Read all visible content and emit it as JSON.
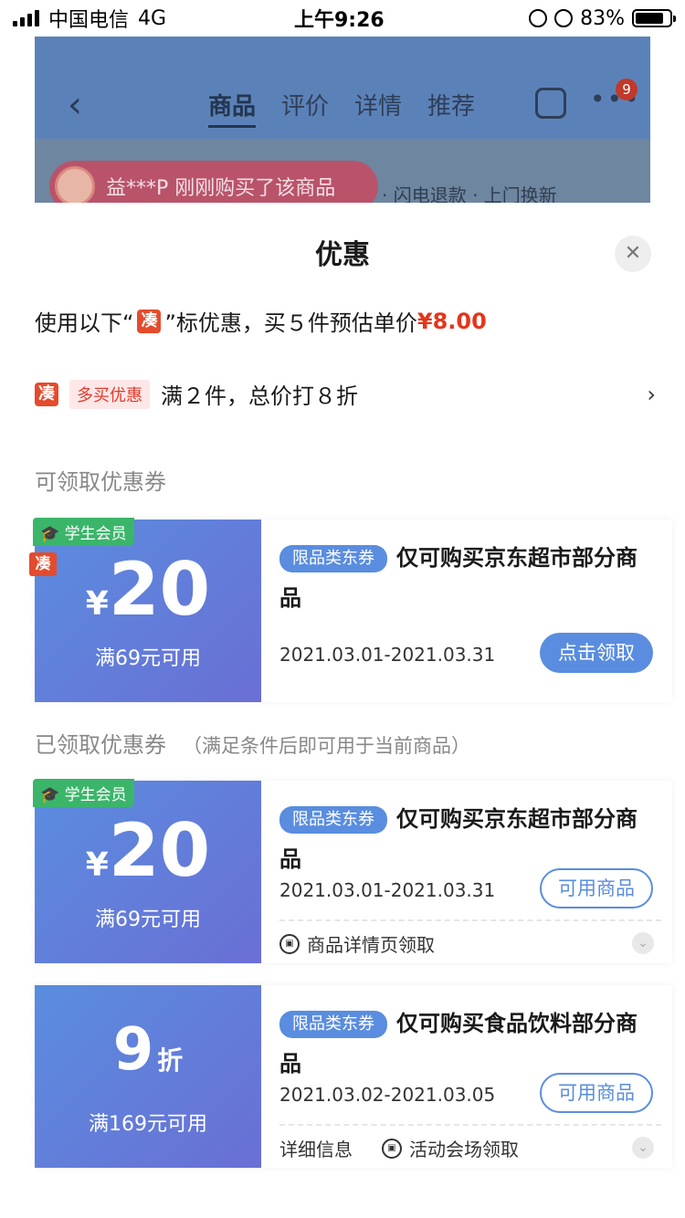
{
  "status_bar": {
    "carrier": "中国电信",
    "network": "4G",
    "time": "上午9:26",
    "battery": "83%",
    "battery_level": 0.83
  },
  "nav": {
    "tabs": [
      "商品",
      "评价",
      "详情",
      "推荐"
    ],
    "badge": "9"
  },
  "banner": {
    "buyer_text": "益***P 刚刚购买了该商品",
    "promo_text": "· 闪电退款 · 上门换新"
  },
  "sheet": {
    "title": "优惠",
    "summary": {
      "prefix": "使用以下“",
      "tag": "凑",
      "suffix": "”标优惠，买５件预估单价",
      "price": "¥8.00"
    },
    "multi_buy": {
      "tag": "凑",
      "label": "多买优惠",
      "text": "满２件，总价打８折"
    },
    "available_title": "可领取优惠券",
    "claimed_title": "已领取优惠券",
    "claimed_note": "（满足条件后即可用于当前商品）",
    "coupons": [
      {
        "badge": "学生会员",
        "mark": "凑",
        "yen": "¥",
        "amount": "20",
        "condition": "满69元可用",
        "type_tag": "限品类东券",
        "desc": "仅可购买京东超市部分商品",
        "date": "2021.03.01-2021.03.31",
        "button": "点击领取"
      },
      {
        "badge": "学生会员",
        "yen": "¥",
        "amount": "20",
        "condition": "满69元可用",
        "type_tag": "限品类东券",
        "desc": "仅可购买京东超市部分商品",
        "date": "2021.03.01-2021.03.31",
        "button": "可用商品",
        "source": "商品详情页领取"
      },
      {
        "amount": "9",
        "unit": "折",
        "condition": "满169元可用",
        "type_tag": "限品类东券",
        "desc": "仅可购买食品饮料部分商品",
        "date": "2021.03.02-2021.03.05",
        "button": "可用商品",
        "info": "详细信息",
        "source": "活动会场领取"
      }
    ]
  }
}
